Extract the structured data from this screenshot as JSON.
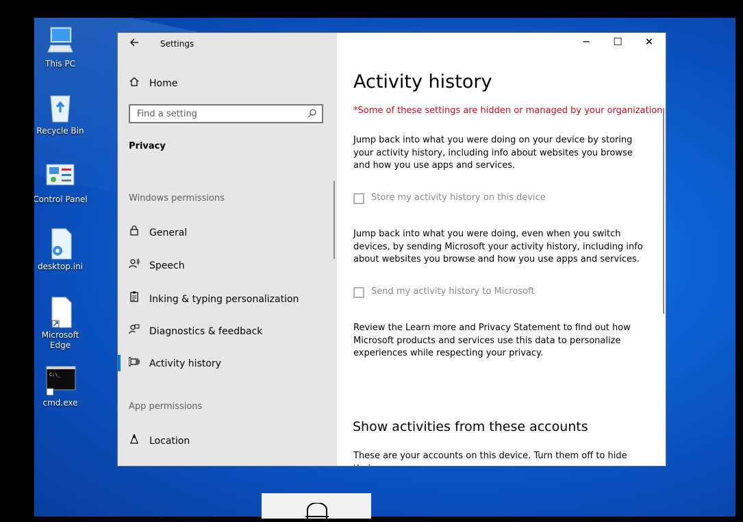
{
  "desktop": {
    "icons": [
      {
        "label": "This PC",
        "icon": "computer-icon"
      },
      {
        "label": "Recycle Bin",
        "icon": "recycle-bin-icon"
      },
      {
        "label": "Control Panel",
        "icon": "control-panel-icon"
      },
      {
        "label": "desktop.ini",
        "icon": "settings-file-icon"
      },
      {
        "label": "Microsoft",
        "label2": "Edge",
        "icon": "shortcut-file-icon"
      },
      {
        "label": "cmd.exe",
        "icon": "terminal-icon"
      }
    ]
  },
  "window": {
    "title": "Settings",
    "controls": {
      "minimize": "─",
      "maximize": "☐",
      "close": "✕"
    }
  },
  "sidebar": {
    "home": "Home",
    "search_placeholder": "Find a setting",
    "category": "Privacy",
    "section_windows": "Windows permissions",
    "items": [
      {
        "label": "General",
        "icon": "lock-icon"
      },
      {
        "label": "Speech",
        "icon": "speech-icon"
      },
      {
        "label": "Inking & typing personalization",
        "icon": "clipboard-icon"
      },
      {
        "label": "Diagnostics & feedback",
        "icon": "feedback-icon"
      },
      {
        "label": "Activity history",
        "icon": "activity-history-icon",
        "selected": true
      }
    ],
    "section_app": "App permissions",
    "app_items": [
      {
        "label": "Location",
        "icon": "location-icon"
      }
    ]
  },
  "main": {
    "title": "Activity history",
    "warning": "*Some of these settings are hidden or managed by your organization.",
    "para1": "Jump back into what you were doing on your device by storing your activity history, including info about websites you browse and how you use apps and services.",
    "check1": "Store my activity history on this device",
    "para2": "Jump back into what you were doing, even when you switch devices, by sending Microsoft your activity history, including info about websites you browse and how you use apps and services.",
    "check2": "Send my activity history to Microsoft",
    "para3": "Review the Learn more and Privacy Statement to find out how Microsoft products and services use this data to personalize experiences while respecting your privacy.",
    "heading2": "Show activities from these accounts",
    "para4": "These are your accounts on this device. Turn them off to hide their"
  },
  "colors": {
    "accent": "#0078d7",
    "warning": "#c50f1f"
  }
}
